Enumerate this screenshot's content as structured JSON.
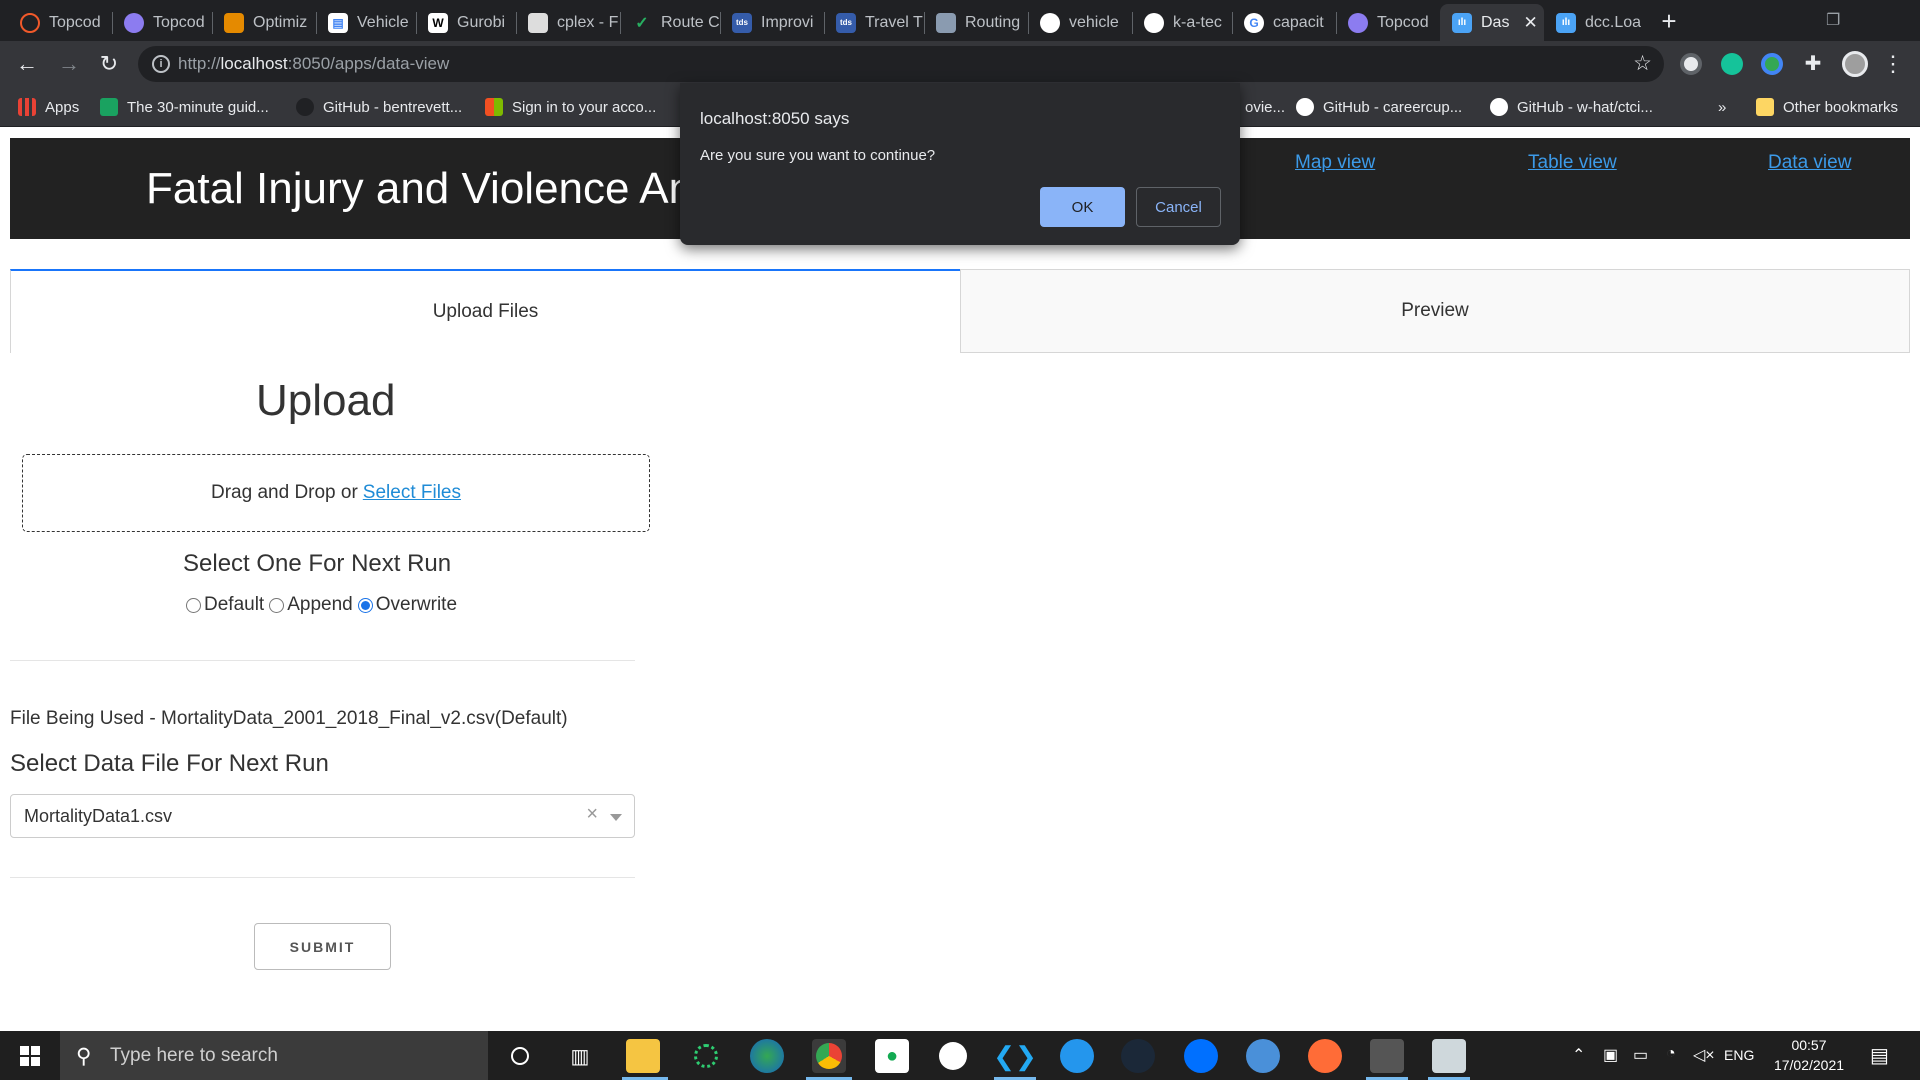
{
  "browser": {
    "tabs": [
      {
        "label": "Topcod",
        "icon": "topcoder-icon",
        "color": "#f1592a"
      },
      {
        "label": "Topcod",
        "icon": "topcoder-icon",
        "color": "#8c7cf0"
      },
      {
        "label": "Optimiz",
        "icon": "book-icon",
        "color": "#e58a00"
      },
      {
        "label": "Vehicle",
        "icon": "document-icon",
        "color": "#4285f4"
      },
      {
        "label": "Gurobi",
        "icon": "wikipedia-icon",
        "color": "#ffffff"
      },
      {
        "label": "cplex - F",
        "icon": "cube-icon",
        "color": "#dddddd"
      },
      {
        "label": "Route C",
        "icon": "check-icon",
        "color": "#27ae60"
      },
      {
        "label": "Improvi",
        "icon": "tds-icon",
        "color": "#355caa"
      },
      {
        "label": "Travel T",
        "icon": "tds-icon",
        "color": "#355caa"
      },
      {
        "label": "Routing",
        "icon": "book-icon",
        "color": "#8a9bb0"
      },
      {
        "label": "vehicle",
        "icon": "github-icon",
        "color": "#ffffff"
      },
      {
        "label": "k-a-tec",
        "icon": "globe-icon",
        "color": "#ffffff"
      },
      {
        "label": "capacit",
        "icon": "google-icon",
        "color": "#ffffff"
      },
      {
        "label": "Topcod",
        "icon": "topcoder-icon",
        "color": "#8c7cf0"
      },
      {
        "label": "Das",
        "icon": "dash-icon",
        "color": "#4ba3f5",
        "active": true
      },
      {
        "label": "dcc.Loa",
        "icon": "dash-icon",
        "color": "#4ba3f5"
      }
    ],
    "url_prefix": "http://",
    "url_host": "localhost",
    "url_rest": ":8050/apps/data-view",
    "bookmarks": [
      {
        "label": "Apps",
        "color": "#e94235"
      },
      {
        "label": "The 30-minute guid...",
        "color": "#1aa260"
      },
      {
        "label": "GitHub - bentrevett...",
        "color": "#202124"
      },
      {
        "label": "Sign in to your acco...",
        "color": "#f25022"
      },
      {
        "label": "ovie...",
        "color": "#35363a"
      },
      {
        "label": "GitHub - careercup...",
        "color": "#ffffff"
      },
      {
        "label": "GitHub - w-hat/ctci...",
        "color": "#ffffff"
      }
    ],
    "bookmarks_more": "»",
    "other_bookmarks": "Other bookmarks"
  },
  "page": {
    "banner_title": "Fatal Injury and Violence Ana",
    "nav": [
      "Map view",
      "Table view",
      "Data view"
    ],
    "tabs": [
      "Upload Files",
      "Preview"
    ],
    "upload_heading": "Upload",
    "dropzone_text": "Drag and Drop or",
    "dropzone_link": "Select Files",
    "run_label": "Select One For Next Run",
    "run_options": [
      "Default",
      "Append",
      "Overwrite"
    ],
    "run_selected": "Overwrite",
    "file_used": "File Being Used - MortalityData_2001_2018_Final_v2.csv(Default)",
    "select_label": "Select Data File For Next Run",
    "selected_file": "MortalityData1.csv",
    "submit_label": "SUBMIT"
  },
  "dialog": {
    "title": "localhost:8050 says",
    "message": "Are you sure you want to continue?",
    "ok_label": "OK",
    "cancel_label": "Cancel"
  },
  "taskbar": {
    "search_placeholder": "Type here to search",
    "language": "ENG",
    "time": "00:57",
    "date": "17/02/2021"
  }
}
